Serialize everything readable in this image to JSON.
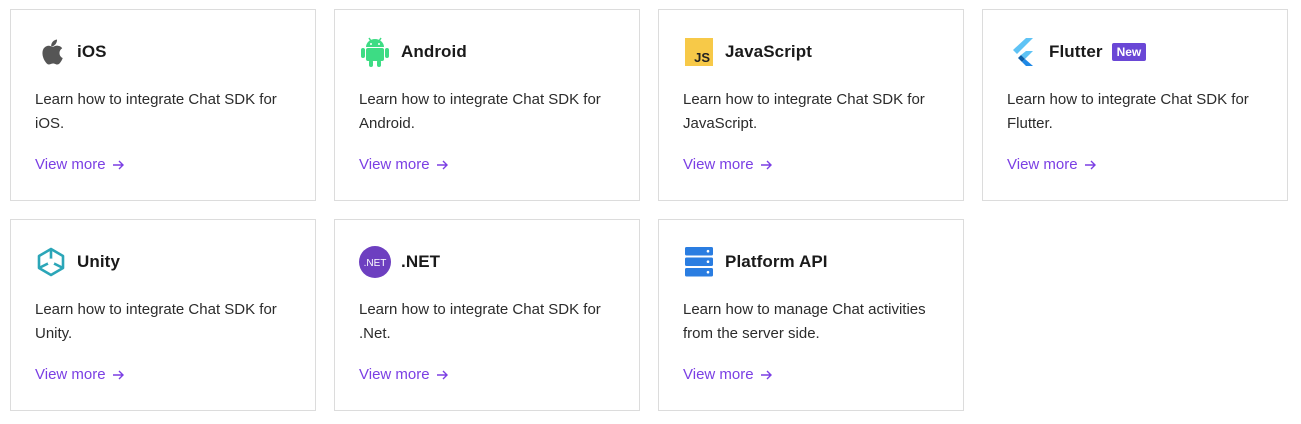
{
  "cards": [
    {
      "title": "iOS",
      "icon": "apple-icon",
      "description": "Learn how to integrate Chat SDK for iOS.",
      "link": "View more"
    },
    {
      "title": "Android",
      "icon": "android-icon",
      "description": "Learn how to integrate Chat SDK for Android.",
      "link": "View more"
    },
    {
      "title": "JavaScript",
      "icon": "javascript-icon",
      "icon_text": "JS",
      "description": "Learn how to integrate Chat SDK for JavaScript.",
      "link": "View more"
    },
    {
      "title": "Flutter",
      "icon": "flutter-icon",
      "badge": "New",
      "description": "Learn how to integrate Chat SDK for Flutter.",
      "link": "View more"
    },
    {
      "title": "Unity",
      "icon": "unity-icon",
      "description": "Learn how to integrate Chat SDK for Unity.",
      "link": "View more"
    },
    {
      "title": ".NET",
      "icon": "dotnet-icon",
      "icon_text": ".NET",
      "description": "Learn how to integrate Chat SDK for .Net.",
      "link": "View more"
    },
    {
      "title": "Platform API",
      "icon": "server-icon",
      "description": "Learn how to manage Chat activities from the server side.",
      "link": "View more"
    }
  ],
  "colors": {
    "link": "#7b3fe4",
    "badge": "#6a47d6",
    "android": "#3ddc84",
    "javascript": "#f7c948",
    "flutter": "#42a5f5",
    "unity": "#2ba6b8",
    "dotnet": "#6d3fc0",
    "server": "#2a7de1"
  }
}
